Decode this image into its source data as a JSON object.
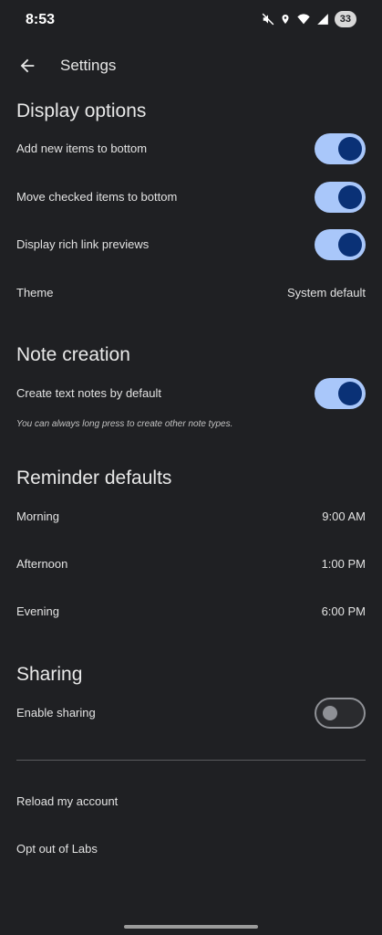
{
  "status_bar": {
    "time": "8:53",
    "battery": "33",
    "icons": [
      "mute-icon",
      "location-icon",
      "wifi-icon",
      "signal-icon",
      "battery-icon"
    ]
  },
  "app_bar": {
    "title": "Settings",
    "back_icon": "arrow-back-icon"
  },
  "display_options": {
    "header": "Display options",
    "add_new_items_bottom": {
      "label": "Add new items to bottom",
      "enabled": true
    },
    "move_checked_items_bottom": {
      "label": "Move checked items to bottom",
      "enabled": true
    },
    "rich_link_previews": {
      "label": "Display rich link previews",
      "enabled": true
    },
    "theme": {
      "label": "Theme",
      "value": "System default"
    }
  },
  "note_creation": {
    "header": "Note creation",
    "text_notes_default": {
      "label": "Create text notes by default",
      "enabled": true
    },
    "helper": "You can always long press to create other note types."
  },
  "reminder_defaults": {
    "header": "Reminder defaults",
    "morning": {
      "label": "Morning",
      "value": "9:00 AM"
    },
    "afternoon": {
      "label": "Afternoon",
      "value": "1:00 PM"
    },
    "evening": {
      "label": "Evening",
      "value": "6:00 PM"
    }
  },
  "sharing": {
    "header": "Sharing",
    "enable_sharing": {
      "label": "Enable sharing",
      "enabled": false
    }
  },
  "other": {
    "reload_account": "Reload my account",
    "opt_out_labs": "Opt out of Labs"
  },
  "colors": {
    "background": "#1f2023",
    "toggle_on_track": "#a9c7fa",
    "toggle_on_thumb": "#0a3176",
    "toggle_off_outline": "#8f9196"
  }
}
